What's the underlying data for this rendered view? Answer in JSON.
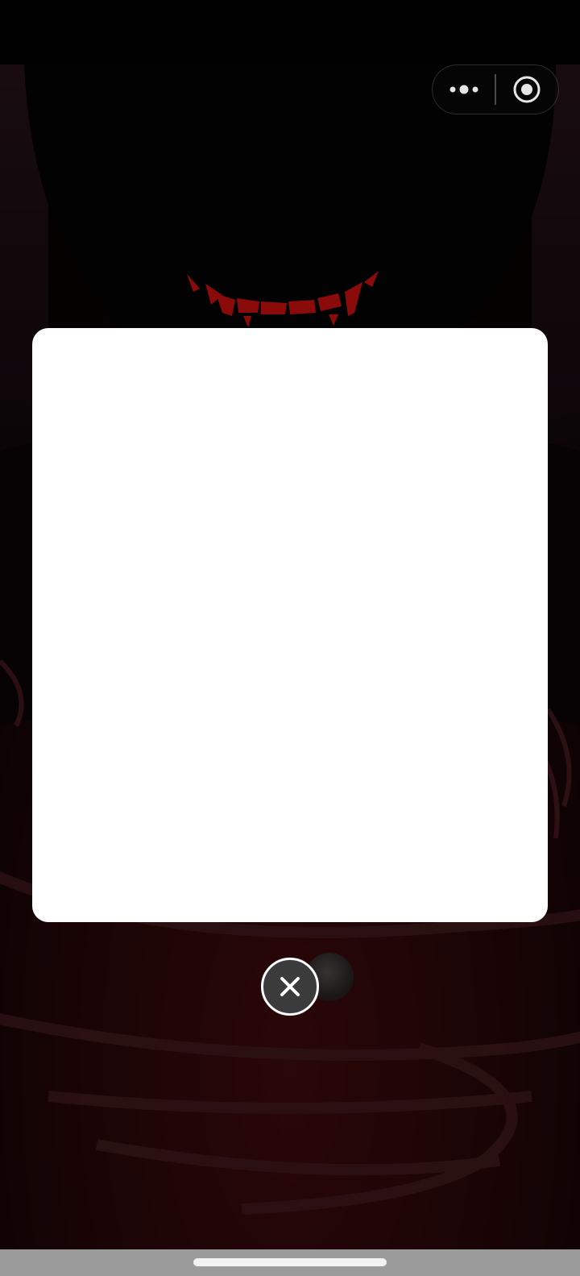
{
  "theme": {
    "background": "#000000",
    "accent_red": "#8b0a0a",
    "modal_background": "#ffffff",
    "close_button_fill": "#3b3b3b",
    "home_bar_area": "#9b9b9b"
  },
  "capsule": {
    "more_icon": "more-dots-icon",
    "close_miniprogram_icon": "target-circle-icon"
  },
  "modal": {
    "content": ""
  },
  "close_button": {
    "icon": "close-x-icon"
  }
}
